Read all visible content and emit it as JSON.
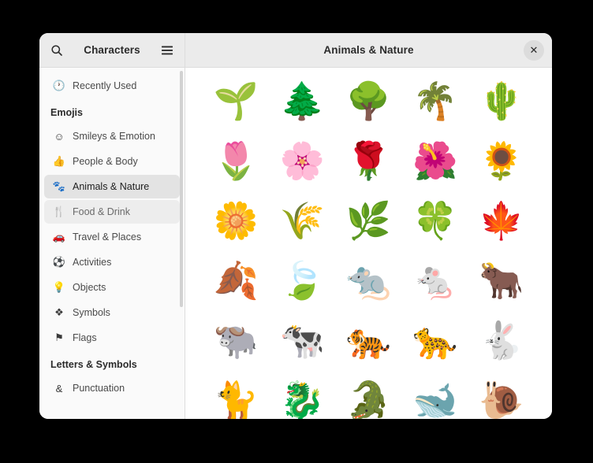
{
  "window": {
    "sidebar_title": "Characters",
    "content_title": "Animals & Nature",
    "search_icon": "search-icon",
    "menu_icon": "hamburger-menu-icon",
    "close_icon": "✕"
  },
  "sidebar": {
    "top_items": [
      {
        "label": "Recently Used",
        "icon": "🕐",
        "state": "normal"
      }
    ],
    "groups": [
      {
        "label": "Emojis",
        "items": [
          {
            "label": "Smileys & Emotion",
            "icon": "☺",
            "state": "normal"
          },
          {
            "label": "People & Body",
            "icon": "👍",
            "state": "normal"
          },
          {
            "label": "Animals & Nature",
            "icon": "🐾",
            "state": "selected"
          },
          {
            "label": "Food & Drink",
            "icon": "🍴",
            "state": "hovered"
          },
          {
            "label": "Travel & Places",
            "icon": "🚗",
            "state": "normal"
          },
          {
            "label": "Activities",
            "icon": "⚽",
            "state": "normal"
          },
          {
            "label": "Objects",
            "icon": "💡",
            "state": "normal"
          },
          {
            "label": "Symbols",
            "icon": "❖",
            "state": "normal"
          },
          {
            "label": "Flags",
            "icon": "⚑",
            "state": "normal"
          }
        ]
      },
      {
        "label": "Letters & Symbols",
        "items": [
          {
            "label": "Punctuation",
            "icon": "&",
            "state": "normal"
          }
        ]
      }
    ]
  },
  "emoji_grid": {
    "columns": 5,
    "cells": [
      {
        "glyph": "🌱",
        "name": "seedling"
      },
      {
        "glyph": "🌲",
        "name": "evergreen-tree"
      },
      {
        "glyph": "🌳",
        "name": "deciduous-tree"
      },
      {
        "glyph": "🌴",
        "name": "palm-tree"
      },
      {
        "glyph": "🌵",
        "name": "cactus"
      },
      {
        "glyph": "🌷",
        "name": "tulip"
      },
      {
        "glyph": "🌸",
        "name": "cherry-blossom"
      },
      {
        "glyph": "🌹",
        "name": "rose"
      },
      {
        "glyph": "🌺",
        "name": "hibiscus"
      },
      {
        "glyph": "🌻",
        "name": "sunflower"
      },
      {
        "glyph": "🌼",
        "name": "blossom"
      },
      {
        "glyph": "🌾",
        "name": "sheaf-of-rice"
      },
      {
        "glyph": "🌿",
        "name": "herb"
      },
      {
        "glyph": "🍀",
        "name": "four-leaf-clover"
      },
      {
        "glyph": "🍁",
        "name": "maple-leaf"
      },
      {
        "glyph": "🍂",
        "name": "fallen-leaf"
      },
      {
        "glyph": "🍃",
        "name": "leaf-fluttering-in-wind"
      },
      {
        "glyph": "🐀",
        "name": "rat"
      },
      {
        "glyph": "🐁",
        "name": "mouse"
      },
      {
        "glyph": "🐂",
        "name": "ox"
      },
      {
        "glyph": "🐃",
        "name": "water-buffalo"
      },
      {
        "glyph": "🐄",
        "name": "cow"
      },
      {
        "glyph": "🐅",
        "name": "tiger"
      },
      {
        "glyph": "🐆",
        "name": "leopard"
      },
      {
        "glyph": "🐇",
        "name": "rabbit"
      },
      {
        "glyph": "🐈",
        "name": "cat"
      },
      {
        "glyph": "🐉",
        "name": "dragon"
      },
      {
        "glyph": "🐊",
        "name": "crocodile"
      },
      {
        "glyph": "🐋",
        "name": "whale"
      },
      {
        "glyph": "🐌",
        "name": "snail"
      }
    ]
  },
  "colors": {
    "header_bg": "#ebebeb",
    "sidebar_bg": "#fafafa",
    "content_bg": "#ffffff",
    "selected_bg": "#e3e3e3",
    "hover_bg": "#ededed",
    "border": "#dcdcdc",
    "text": "#2b2b2b",
    "desktop_bg": "#000000"
  }
}
